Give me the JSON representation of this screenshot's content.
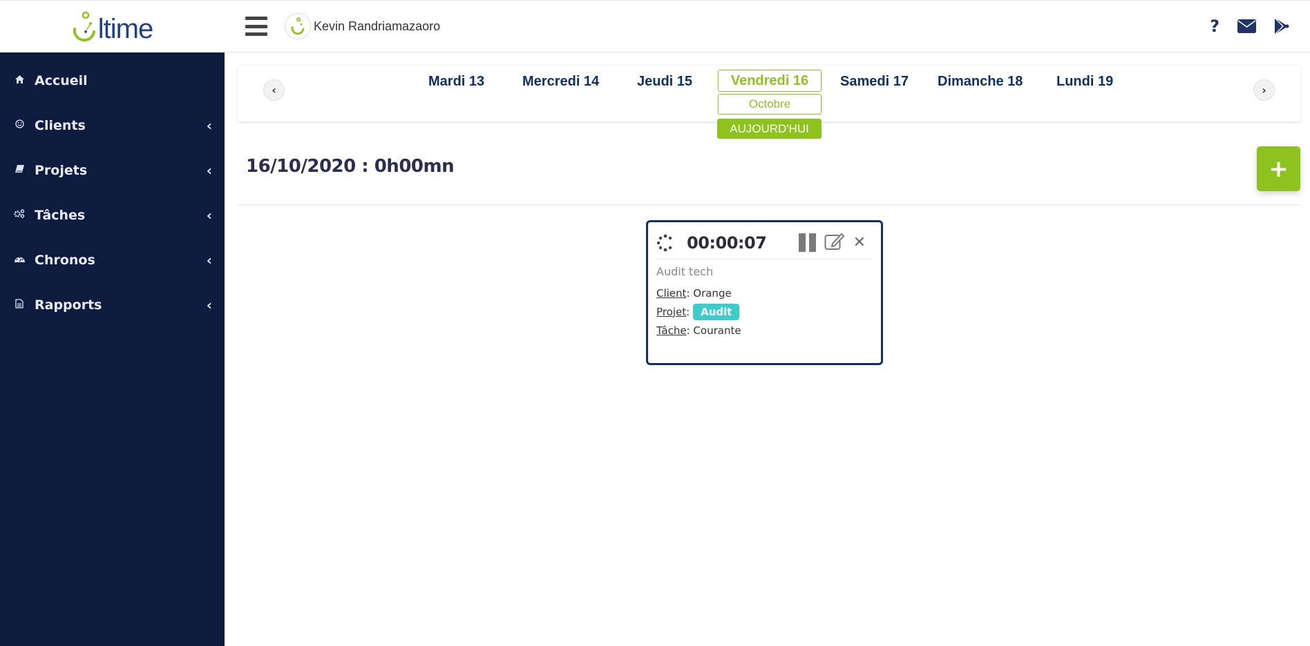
{
  "brand": {
    "logo_text": "ltime",
    "green": "#8ec31e",
    "navy": "#0d1b3e"
  },
  "sidebar": {
    "items": [
      {
        "label": "Accueil",
        "icon": "home-icon",
        "expandable": false
      },
      {
        "label": "Clients",
        "icon": "smile-icon",
        "expandable": true
      },
      {
        "label": "Projets",
        "icon": "book-icon",
        "expandable": true
      },
      {
        "label": "Tâches",
        "icon": "cogs-icon",
        "expandable": true
      },
      {
        "label": "Chronos",
        "icon": "dashboard-icon",
        "expandable": true
      },
      {
        "label": "Rapports",
        "icon": "file-text-icon",
        "expandable": true
      }
    ]
  },
  "header": {
    "username": "Kevin Randriamazaoro",
    "icons": [
      "help-icon",
      "mail-icon",
      "play-store-icon"
    ],
    "help_glyph": "?"
  },
  "datebar": {
    "prev_glyph": "‹",
    "next_glyph": "›",
    "days": [
      {
        "label": "Mardi 13"
      },
      {
        "label": "Mercredi 14"
      },
      {
        "label": "Jeudi 15"
      },
      {
        "label": "Vendredi 16",
        "active": true
      },
      {
        "label": "Samedi 17"
      },
      {
        "label": "Dimanche 18"
      },
      {
        "label": "Lundi 19"
      }
    ],
    "month": "Octobre",
    "today_label": "AUJOURD'HUI"
  },
  "summary": {
    "text": "16/10/2020 : 0h00mn"
  },
  "add_button": {
    "glyph": "+"
  },
  "timer_card": {
    "elapsed": "00:00:07",
    "close_glyph": "✕",
    "title": "Audit tech",
    "client_label": "Client",
    "client_value": "Orange",
    "project_label": "Projet",
    "project_value": "Audit",
    "project_badge_color": "#3bcdcc",
    "task_label": "Tâche",
    "task_value": "Courante"
  }
}
